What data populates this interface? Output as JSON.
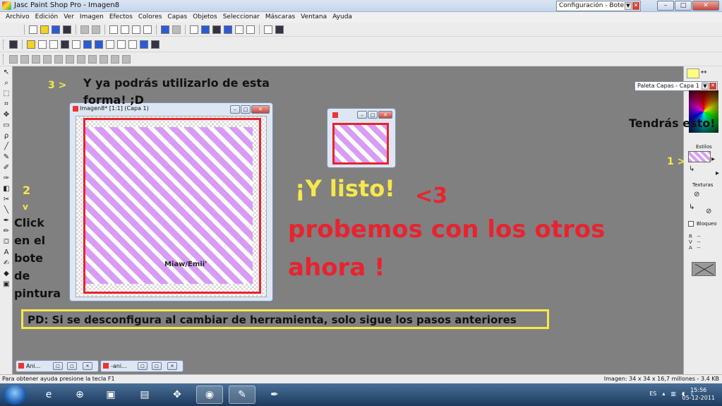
{
  "window": {
    "title": "Jasc Paint Shop Pro - Imagen8",
    "config_window_title": "Configuración - Bote d",
    "min_label": "–",
    "max_label": "□",
    "close_label": "✕"
  },
  "menu": [
    "Archivo",
    "Edición",
    "Ver",
    "Imagen",
    "Efectos",
    "Colores",
    "Capas",
    "Objetos",
    "Seleccionar",
    "Máscaras",
    "Ventana",
    "Ayuda"
  ],
  "image_window": {
    "title": "Imagen8* [1:1] (Capa 1)",
    "watermark": "Miaw/Emii'"
  },
  "palette": {
    "title": "Paleta Capas - Capa 1",
    "swap": "↔",
    "estilos": "Estilos",
    "texturas": "Texturas",
    "bloqueo": "Bloqueo",
    "rva": "R   --\nV   --\nA   --"
  },
  "annotations": {
    "step3": "3 >",
    "step3_text": "Y ya podrás utilizarlo de esta forma! ;D",
    "step2_num": "2",
    "step2_arrow": "v",
    "click_text": "Click en el bote de pintura",
    "step1": "1 >",
    "tendras": "Tendrás esto!",
    "listo": "¡Y listo!",
    "heart": "<3",
    "probemos": "probemos con los otros ahora !",
    "pd": "PD: Si se desconfigura al cambiar de herramienta, solo sigue los pasos anteriores"
  },
  "minimized": [
    {
      "label": "Ani..."
    },
    {
      "label": "-ani..."
    }
  ],
  "status": {
    "help": "Para obtener ayuda presione la tecla F1",
    "image_info": "Imagen:  34 x 34 x 16,7 millones - 3.4 KB"
  },
  "taskbar": {
    "lang": "ES",
    "time": "15:56",
    "date": "05-12-2011"
  },
  "colors": {
    "accent_red": "#e8232f",
    "accent_yellow": "#f7e84a",
    "stripe": "#d89cf4"
  }
}
